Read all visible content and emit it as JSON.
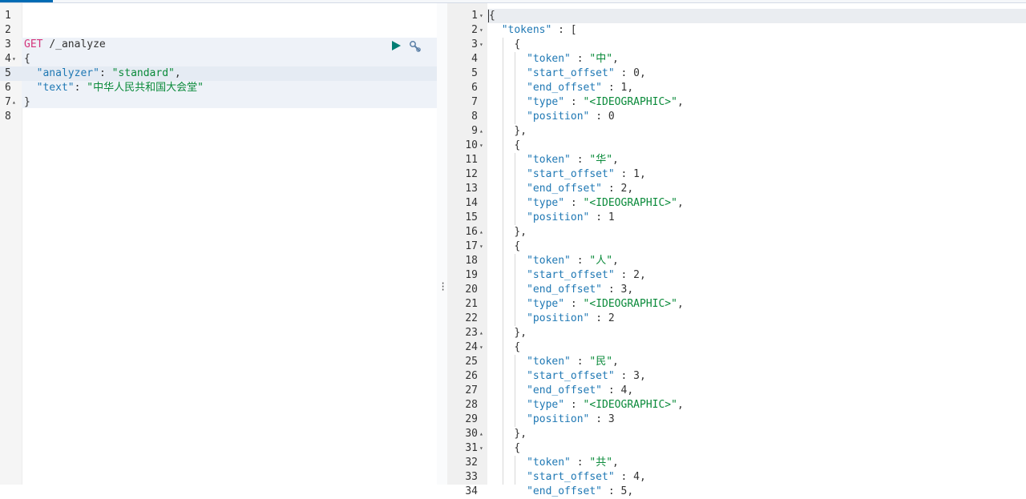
{
  "request": {
    "method": "GET",
    "path": "/_analyze",
    "line_numbers": [
      "1",
      "2",
      "3",
      "4",
      "5",
      "6",
      "7",
      "8"
    ],
    "open_brace": "{",
    "close_brace": "}",
    "analyzer_key": "\"analyzer\"",
    "analyzer_value": "\"standard\"",
    "text_key": "\"text\"",
    "text_value": "\"中华人民共和国大会堂\"",
    "run_icon": "play-icon",
    "settings_icon": "wrench-icon"
  },
  "response": {
    "first_lines": [
      "{",
      "\"tokens\" : ["
    ],
    "tokens": [
      {
        "token": "\"中\"",
        "start_offset": "0",
        "end_offset": "1",
        "type": "\"<IDEOGRAPHIC>\"",
        "position": "0"
      },
      {
        "token": "\"华\"",
        "start_offset": "1",
        "end_offset": "2",
        "type": "\"<IDEOGRAPHIC>\"",
        "position": "1"
      },
      {
        "token": "\"人\"",
        "start_offset": "2",
        "end_offset": "3",
        "type": "\"<IDEOGRAPHIC>\"",
        "position": "2"
      },
      {
        "token": "\"民\"",
        "start_offset": "3",
        "end_offset": "4",
        "type": "\"<IDEOGRAPHIC>\"",
        "position": "3"
      },
      {
        "token": "\"共\"",
        "start_offset": "4",
        "end_offset": "5"
      }
    ],
    "keys": {
      "token": "\"token\"",
      "start_offset": "\"start_offset\"",
      "end_offset": "\"end_offset\"",
      "type": "\"type\"",
      "position": "\"position\""
    },
    "line_numbers": [
      "1",
      "2",
      "3",
      "4",
      "5",
      "6",
      "7",
      "8",
      "9",
      "10",
      "11",
      "12",
      "13",
      "14",
      "15",
      "16",
      "17",
      "18",
      "19",
      "20",
      "21",
      "22",
      "23",
      "24",
      "25",
      "26",
      "27",
      "28",
      "29",
      "30",
      "31",
      "32",
      "33",
      "34"
    ]
  },
  "colors": {
    "accent": "#006bb4",
    "key": "#1f78b4",
    "string": "#0a8a3a",
    "method": "#d4347a",
    "run_button": "#017d73"
  }
}
